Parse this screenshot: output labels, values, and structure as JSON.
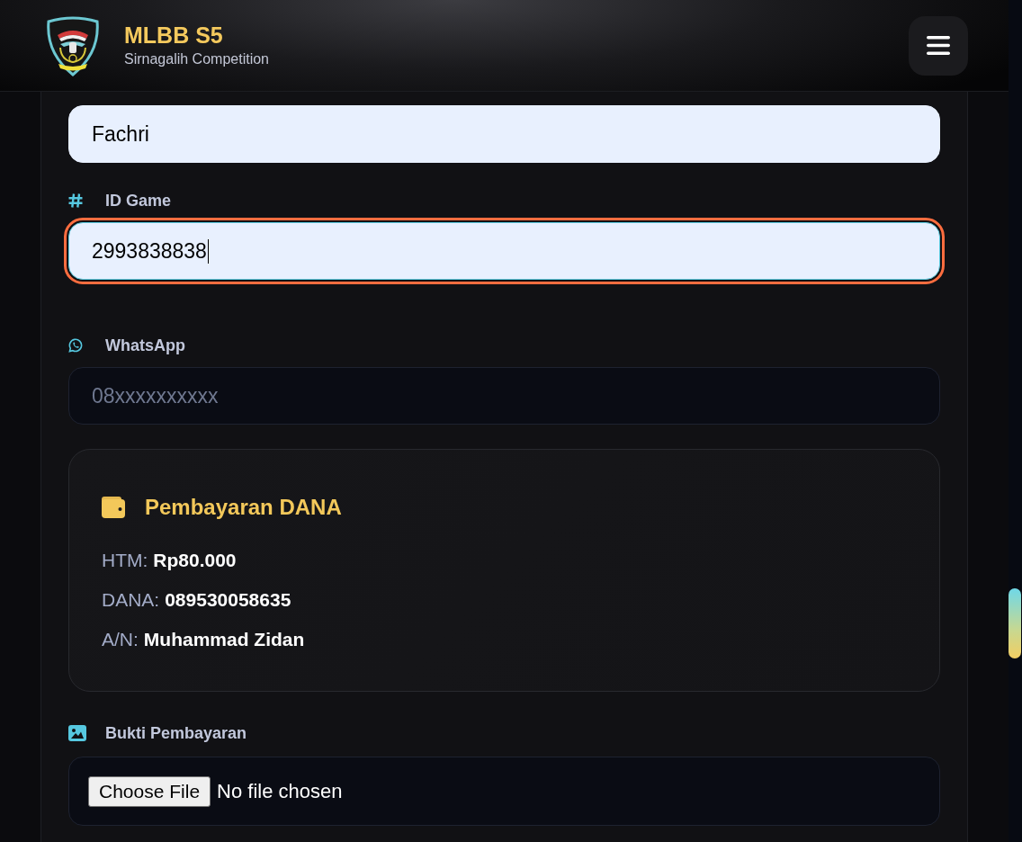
{
  "header": {
    "title": "MLBB S5",
    "subtitle": "Sirnagalih Competition"
  },
  "form": [
    {
      "kind": "input",
      "value": "Fachri",
      "autofilled": true,
      "focused": false
    },
    {
      "kind": "input",
      "label": "ID Game",
      "value": "2993838838",
      "autofilled": true,
      "focused": true
    },
    {
      "kind": "input",
      "label": "WhatsApp",
      "placeholder": "08xxxxxxxxxx",
      "autofilled": false,
      "focused": false
    },
    {
      "kind": "payment",
      "title": "Pembayaran DANA",
      "lines": [
        {
          "label": "HTM:",
          "value": "Rp80.000"
        },
        {
          "label": "DANA:",
          "value": "089530058635"
        },
        {
          "label": "A/N:",
          "value": "Muhammad Zidan"
        }
      ]
    },
    {
      "kind": "file",
      "label": "Bukti Pembayaran",
      "button": "Choose File",
      "status": "No file chosen"
    }
  ]
}
